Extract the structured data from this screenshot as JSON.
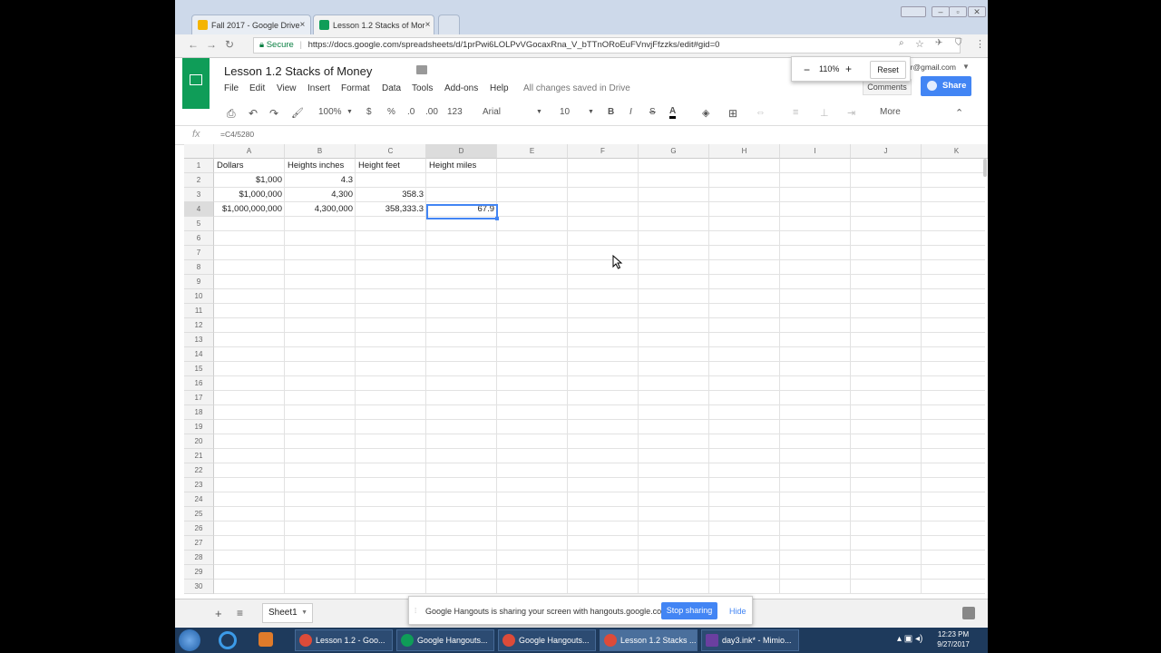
{
  "browser": {
    "tabs": [
      {
        "title": "Fall 2017 - Google Drive",
        "close": "×"
      },
      {
        "title": "Lesson 1.2 Stacks of Mor",
        "close": "×"
      }
    ],
    "secure_label": "Secure",
    "url": "https://docs.google.com/spreadsheets/d/1prPwi6LOLPvVGocaxRna_V_bTTnORoEuFVnvjFfzzks/edit#gid=0",
    "account": "er@gmail.com",
    "zoom": {
      "minus": "−",
      "value": "110%",
      "plus": "+",
      "reset": "Reset"
    }
  },
  "doc": {
    "title": "Lesson 1.2 Stacks of Money",
    "menus": [
      "File",
      "Edit",
      "View",
      "Insert",
      "Format",
      "Data",
      "Tools",
      "Add-ons",
      "Help"
    ],
    "save_status": "All changes saved in Drive",
    "comments": "Comments",
    "share": "Share"
  },
  "toolbar": {
    "zoom": "100%",
    "currency": "$",
    "percent": "%",
    "dec_less": ".0",
    "dec_more": ".00",
    "format": "123",
    "font": "Arial",
    "size": "10",
    "bold": "B",
    "italic": "I",
    "strike": "S",
    "textcolor": "A",
    "more": "More"
  },
  "formula": {
    "fx": "fx",
    "value": "=C4/5280"
  },
  "grid": {
    "columns": [
      "A",
      "B",
      "C",
      "D",
      "E",
      "F",
      "G",
      "H",
      "I",
      "J",
      "K"
    ],
    "rows": [
      "1",
      "2",
      "3",
      "4",
      "5",
      "6",
      "7",
      "8",
      "9",
      "10",
      "11",
      "12",
      "13",
      "14",
      "15",
      "16",
      "17",
      "18",
      "19",
      "20",
      "21",
      "22",
      "23",
      "24",
      "25",
      "26",
      "27",
      "28",
      "29",
      "30"
    ],
    "cells": {
      "A1": "Dollars",
      "B1": "Heights inches",
      "C1": "Height feet",
      "D1": "Height miles",
      "A2": "$1,000",
      "B2": "4.3",
      "A3": "$1,000,000",
      "B3": "4,300",
      "C3": "358.3",
      "A4": "$1,000,000,000",
      "B4": "4,300,000",
      "C4": "358,333.3",
      "D4": "67.9"
    }
  },
  "sheets": {
    "add": "+",
    "list": "≡",
    "tab": "Sheet1"
  },
  "hangouts": {
    "message": "Google Hangouts is sharing your screen with hangouts.google.com.",
    "stop": "Stop sharing",
    "hide": "Hide"
  },
  "taskbar": {
    "items": [
      "Lesson 1.2 - Goo...",
      "Google Hangouts...",
      "Google Hangouts...",
      "Lesson 1.2 Stacks ...",
      "day3.ink* - Mimio..."
    ],
    "time": "12:23 PM",
    "date": "9/27/2017"
  }
}
